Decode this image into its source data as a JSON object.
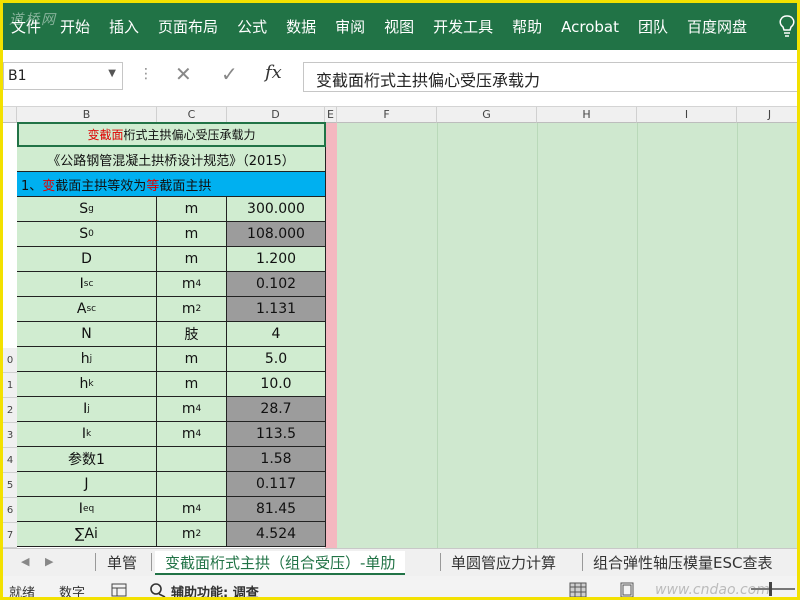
{
  "ribbon": {
    "watermark": "道桥网",
    "items": [
      "文件",
      "开始",
      "插入",
      "页面布局",
      "公式",
      "数据",
      "审阅",
      "视图",
      "开发工具",
      "帮助",
      "Acrobat",
      "团队",
      "百度网盘"
    ]
  },
  "formula_bar": {
    "name_box": "B1",
    "fx_label": "fx",
    "formula": "变截面桁式主拱偏心受压承载力"
  },
  "columns": [
    "B",
    "C",
    "D",
    "E",
    "F",
    "G",
    "H",
    "I",
    "J"
  ],
  "row_numbers": [
    "0",
    "1",
    "2",
    "3",
    "4",
    "5",
    "6",
    "7"
  ],
  "sheet": {
    "title_red": "变截面",
    "title_rest": "桁式主拱偏心受压承载力",
    "code_ref": "《公路钢管混凝土拱桥设计规范》（2015）",
    "section_prefix": "1、",
    "section_red1": "变",
    "section_mid": "截面主拱等效为",
    "section_red2": "等",
    "section_end": "截面主拱",
    "rows": [
      {
        "sym": "S",
        "sub": "g",
        "unit": "m",
        "unit_sup": "",
        "value": "300.000",
        "gray": false
      },
      {
        "sym": "S",
        "sub": "0",
        "unit": "m",
        "unit_sup": "",
        "value": "108.000",
        "gray": true
      },
      {
        "sym": "D",
        "sub": "",
        "unit": "m",
        "unit_sup": "",
        "value": "1.200",
        "gray": false
      },
      {
        "sym": "I",
        "sub": "sc",
        "unit": "m",
        "unit_sup": "4",
        "value": "0.102",
        "gray": true
      },
      {
        "sym": "A",
        "sub": "sc",
        "unit": "m",
        "unit_sup": "2",
        "value": "1.131",
        "gray": true
      },
      {
        "sym": "N",
        "sub": "",
        "unit": "肢",
        "unit_sup": "",
        "value": "4",
        "gray": false
      },
      {
        "sym": "h",
        "sub": "j",
        "unit": "m",
        "unit_sup": "",
        "value": "5.0",
        "gray": false
      },
      {
        "sym": "h",
        "sub": "k",
        "unit": "m",
        "unit_sup": "",
        "value": "10.0",
        "gray": false
      },
      {
        "sym": "I",
        "sub": "j",
        "unit": "m",
        "unit_sup": "4",
        "value": "28.7",
        "gray": true
      },
      {
        "sym": "I",
        "sub": "k",
        "unit": "m",
        "unit_sup": "4",
        "value": "113.5",
        "gray": true
      },
      {
        "sym": "参数1",
        "sub": "",
        "unit": "",
        "unit_sup": "",
        "value": "1.58",
        "gray": true
      },
      {
        "sym": "J",
        "sub": "",
        "unit": "",
        "unit_sup": "",
        "value": "0.117",
        "gray": true
      },
      {
        "sym": "I",
        "sub": "eq",
        "unit": "m",
        "unit_sup": "4",
        "value": "81.45",
        "gray": true
      },
      {
        "sym": "∑Ai",
        "sub": "",
        "unit": "m",
        "unit_sup": "2",
        "value": "4.524",
        "gray": true
      }
    ]
  },
  "tabs": {
    "items": [
      "单管",
      "变截面桁式主拱（组合受压）-单肋",
      "单圆管应力计算",
      "组合弹性轴压模量ESC查表"
    ],
    "active_index": 1
  },
  "status": {
    "ready": "就绪",
    "mode": "数字",
    "accessibility": "辅助功能: 调查",
    "site_watermark": "www.cndao.com"
  },
  "colors": {
    "ribbon": "#217346",
    "cell_green": "#d0ecd0",
    "cell_gray": "#9c9c9c",
    "section_blue": "#00b0f0",
    "accent_red": "#e00000"
  }
}
